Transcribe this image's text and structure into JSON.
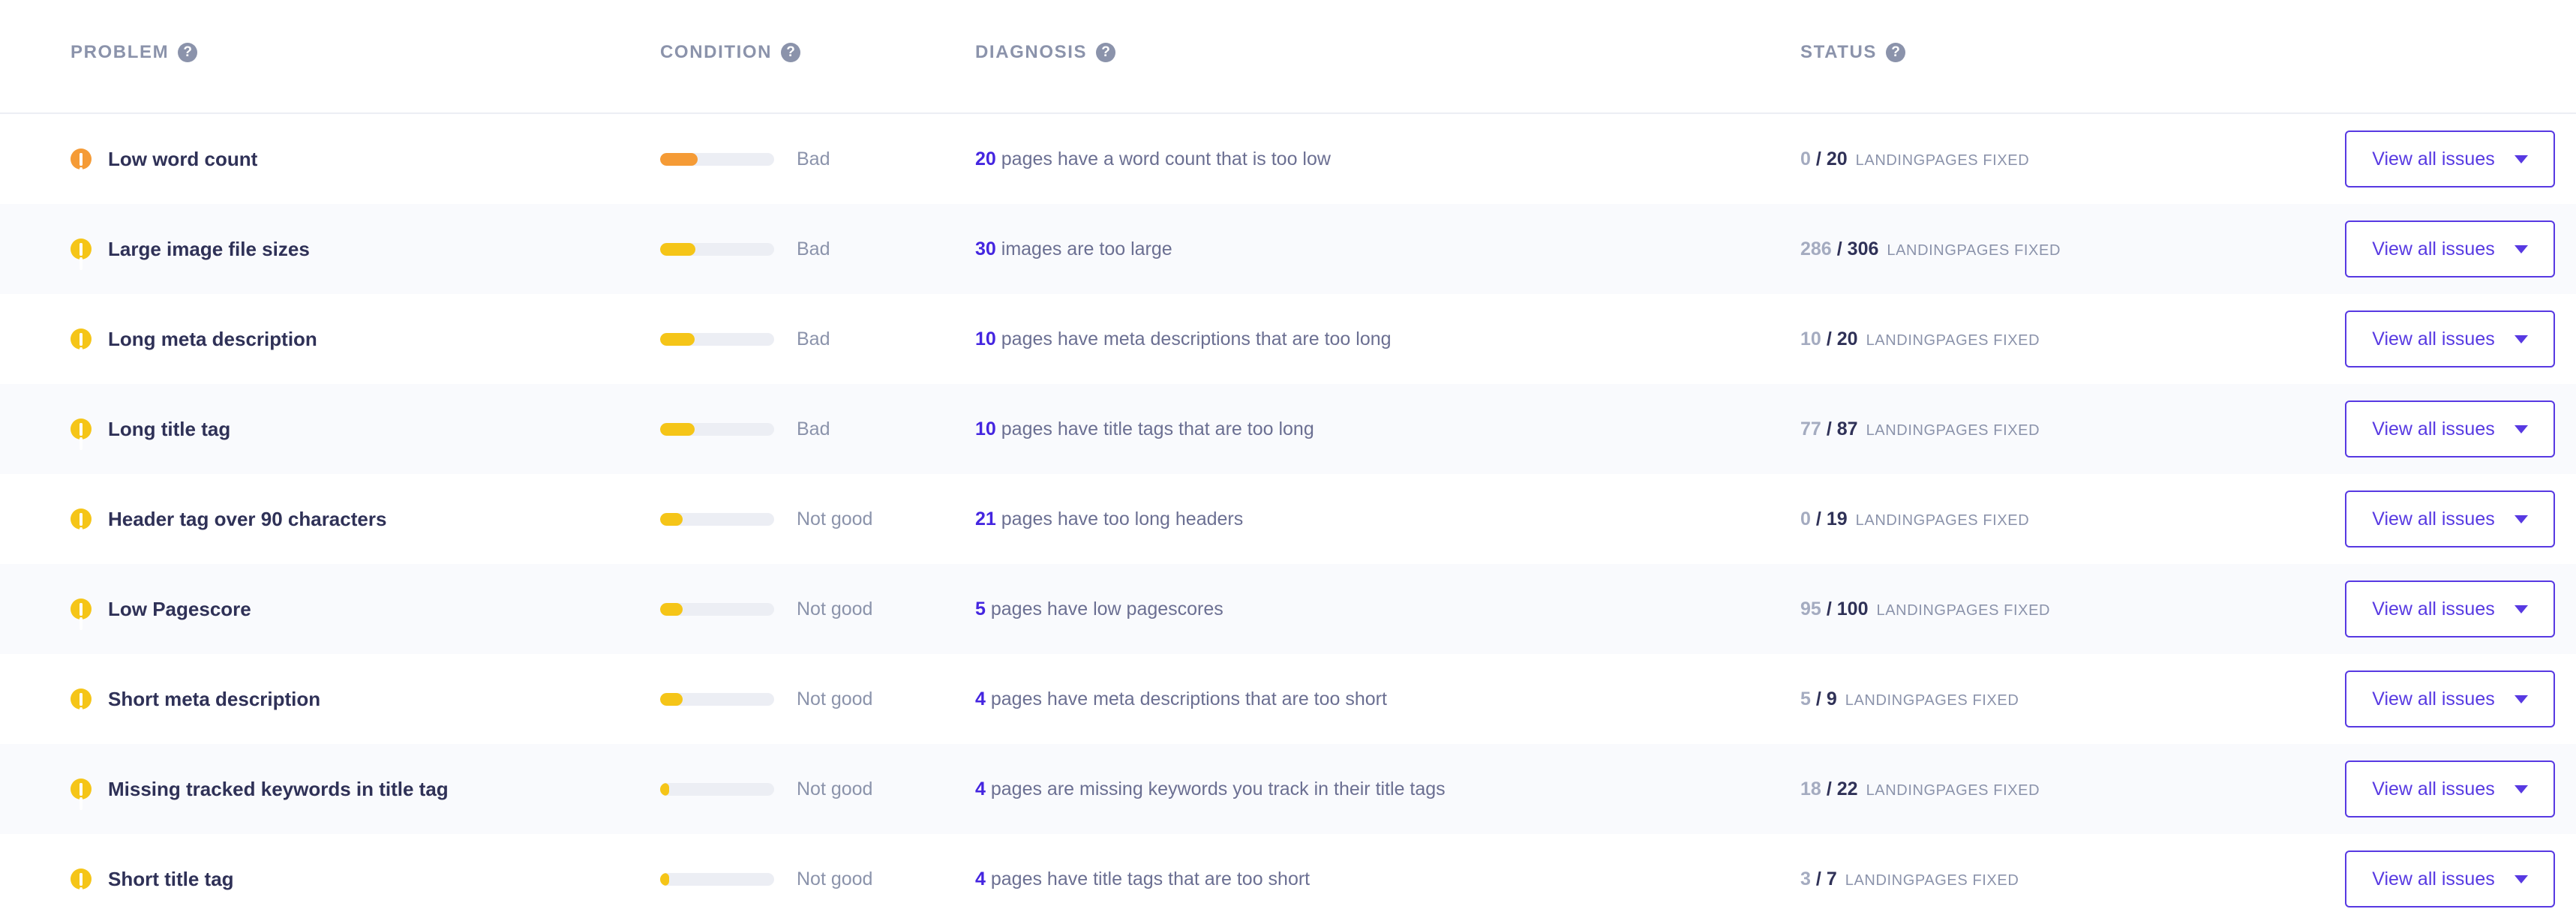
{
  "colors": {
    "accent_purple": "#5739e2",
    "number_purple": "#4425e0",
    "text_dark": "#2f3157",
    "text_muted": "#8b93ab",
    "row_alt_bg": "#f9fafd",
    "bar_track": "#eceef4",
    "severity_orange": "#f59b36",
    "severity_yellow": "#f5c518"
  },
  "header": {
    "columns": [
      {
        "label": "PROBLEM",
        "help_icon": "help-circle-icon"
      },
      {
        "label": "CONDITION",
        "help_icon": "help-circle-icon"
      },
      {
        "label": "DIAGNOSIS",
        "help_icon": "help-circle-icon"
      },
      {
        "label": "STATUS",
        "help_icon": "help-circle-icon"
      }
    ]
  },
  "status_caption": "LANDINGPAGES FIXED",
  "button_label": "View all issues",
  "rows": [
    {
      "severity_icon": "warning-circle-icon",
      "severity_color": "#f59b36",
      "problem": "Low word count",
      "bar_percent": 33,
      "bar_color": "#f59b36",
      "condition": "Bad",
      "diagnosis_count": "20",
      "diagnosis_text": "pages have a word count that is too low",
      "status_done": "0",
      "status_total": "20",
      "alt_bg": false
    },
    {
      "severity_icon": "warning-circle-icon",
      "severity_color": "#f5c518",
      "problem": "Large image file sizes",
      "bar_percent": 31,
      "bar_color": "#f5c518",
      "condition": "Bad",
      "diagnosis_count": "30",
      "diagnosis_text": "images are too large",
      "status_done": "286",
      "status_total": "306",
      "alt_bg": true
    },
    {
      "severity_icon": "warning-circle-icon",
      "severity_color": "#f5c518",
      "problem": "Long meta description",
      "bar_percent": 30,
      "bar_color": "#f5c518",
      "condition": "Bad",
      "diagnosis_count": "10",
      "diagnosis_text": "pages have meta descriptions that are too long",
      "status_done": "10",
      "status_total": "20",
      "alt_bg": false
    },
    {
      "severity_icon": "warning-circle-icon",
      "severity_color": "#f5c518",
      "problem": "Long title tag",
      "bar_percent": 30,
      "bar_color": "#f5c518",
      "condition": "Bad",
      "diagnosis_count": "10",
      "diagnosis_text": "pages have title tags that are too long",
      "status_done": "77",
      "status_total": "87",
      "alt_bg": true
    },
    {
      "severity_icon": "warning-circle-icon",
      "severity_color": "#f5c518",
      "problem": "Header tag over 90 characters",
      "bar_percent": 20,
      "bar_color": "#f5c518",
      "condition": "Not good",
      "diagnosis_count": "21",
      "diagnosis_text": "pages have too long headers",
      "status_done": "0",
      "status_total": "19",
      "alt_bg": false
    },
    {
      "severity_icon": "warning-circle-icon",
      "severity_color": "#f5c518",
      "problem": "Low Pagescore",
      "bar_percent": 20,
      "bar_color": "#f5c518",
      "condition": "Not good",
      "diagnosis_count": "5",
      "diagnosis_text": "pages have low pagescores",
      "status_done": "95",
      "status_total": "100",
      "alt_bg": true
    },
    {
      "severity_icon": "warning-circle-icon",
      "severity_color": "#f5c518",
      "problem": "Short meta description",
      "bar_percent": 20,
      "bar_color": "#f5c518",
      "condition": "Not good",
      "diagnosis_count": "4",
      "diagnosis_text": "pages have meta descriptions that are too short",
      "status_done": "5",
      "status_total": "9",
      "alt_bg": false
    },
    {
      "severity_icon": "warning-circle-icon",
      "severity_color": "#f5c518",
      "problem": "Missing tracked keywords in title tag",
      "bar_percent": 8,
      "bar_color": "#f5c518",
      "condition": "Not good",
      "diagnosis_count": "4",
      "diagnosis_text": "pages are missing keywords you track in their title tags",
      "status_done": "18",
      "status_total": "22",
      "alt_bg": true
    },
    {
      "severity_icon": "warning-circle-icon",
      "severity_color": "#f5c518",
      "problem": "Short title tag",
      "bar_percent": 8,
      "bar_color": "#f5c518",
      "condition": "Not good",
      "diagnosis_count": "4",
      "diagnosis_text": "pages have title tags that are too short",
      "status_done": "3",
      "status_total": "7",
      "alt_bg": false
    }
  ]
}
